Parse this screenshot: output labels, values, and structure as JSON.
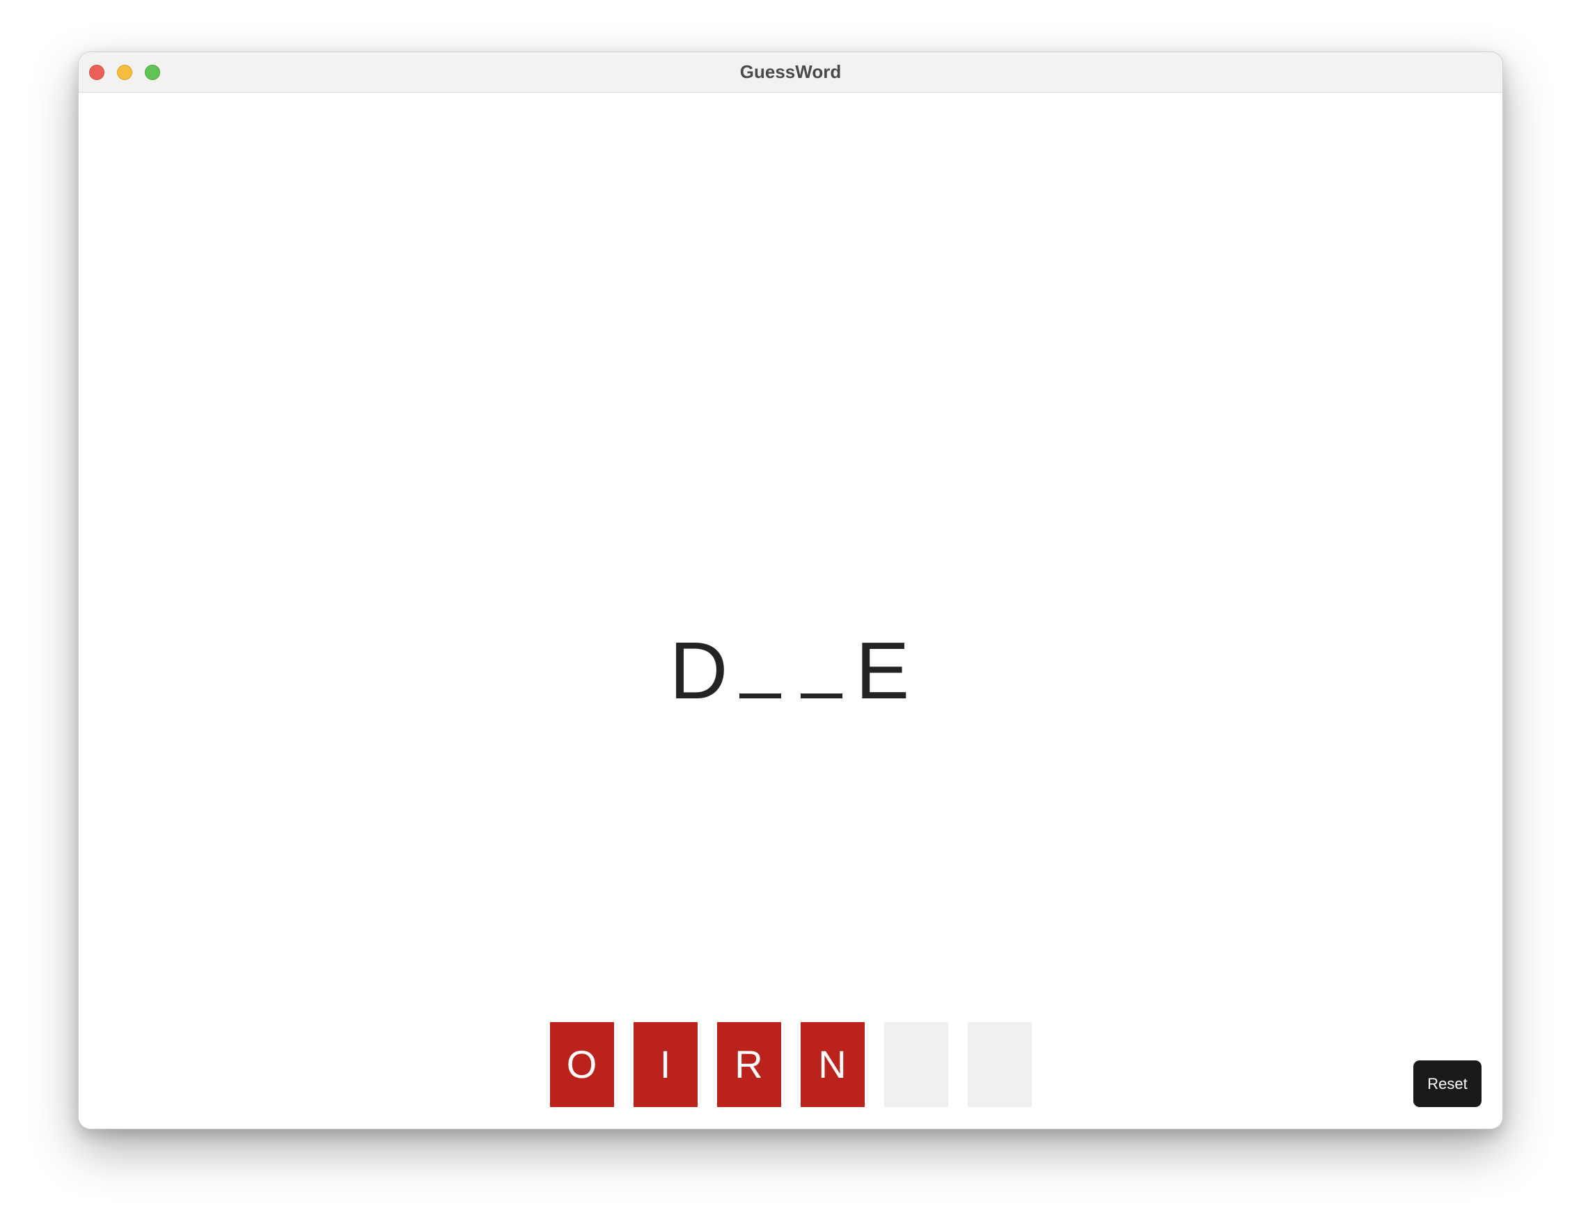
{
  "window": {
    "title": "GuessWord"
  },
  "puzzle": {
    "letters": [
      "D",
      "",
      "",
      "E"
    ]
  },
  "guesses": [
    {
      "letter": "O",
      "status": "wrong"
    },
    {
      "letter": "I",
      "status": "wrong"
    },
    {
      "letter": "R",
      "status": "wrong"
    },
    {
      "letter": "N",
      "status": "wrong"
    },
    {
      "letter": "",
      "status": "empty"
    },
    {
      "letter": "",
      "status": "empty"
    }
  ],
  "controls": {
    "reset_label": "Reset"
  },
  "colors": {
    "wrong_guess": "#ba231c",
    "empty_guess": "#f0f0f0",
    "button_bg": "#1a1a1a",
    "text": "#232323"
  }
}
